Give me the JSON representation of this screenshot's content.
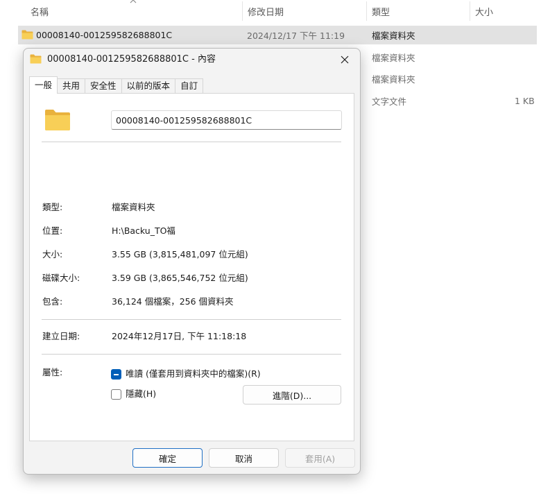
{
  "explorer": {
    "columns": {
      "name": "名稱",
      "modified": "修改日期",
      "type": "類型",
      "size": "大小"
    },
    "rows": [
      {
        "name": "00008140-001259582688801C",
        "modified": "2024/12/17 下午 11:19",
        "type": "檔案資料夾",
        "size": ""
      },
      {
        "name": "",
        "modified": "",
        "type": "檔案資料夾",
        "size": ""
      },
      {
        "name": "",
        "modified": "",
        "type": "檔案資料夾",
        "size": ""
      },
      {
        "name": "",
        "modified": "",
        "type": "文字文件",
        "size": "1 KB"
      }
    ]
  },
  "dialog": {
    "title": "00008140-001259582688801C - 內容",
    "close_icon": "close-icon",
    "tabs": [
      "一般",
      "共用",
      "安全性",
      "以前的版本",
      "自訂"
    ],
    "active_tab": "一般",
    "general": {
      "folder_name": "00008140-001259582688801C",
      "type_label": "類型:",
      "type_value": "檔案資料夾",
      "location_label": "位置:",
      "location_value": "H:\\Backu_TO福",
      "size_label": "大小:",
      "size_value": "3.55 GB (3,815,481,097 位元組)",
      "disk_size_label": "磁碟大小:",
      "disk_size_value": "3.59 GB (3,865,546,752 位元組)",
      "contains_label": "包含:",
      "contains_value": "36,124 個檔案，256 個資料夾",
      "created_label": "建立日期:",
      "created_value": "2024年12月17日, 下午 11:18:18",
      "attributes_label": "屬性:",
      "readonly_label": "唯讀 (僅套用到資料夾中的檔案)(R)",
      "readonly_state": "indeterminate",
      "hidden_label": "隱藏(H)",
      "hidden_state": "unchecked",
      "advanced_button": "進階(D)..."
    },
    "buttons": {
      "ok": "確定",
      "cancel": "取消",
      "apply": "套用(A)"
    }
  },
  "colors": {
    "folder_yellow": "#f8cf57",
    "folder_back": "#e9b23d",
    "accent": "#005fb8",
    "selected_row": "#e2e2e2"
  }
}
